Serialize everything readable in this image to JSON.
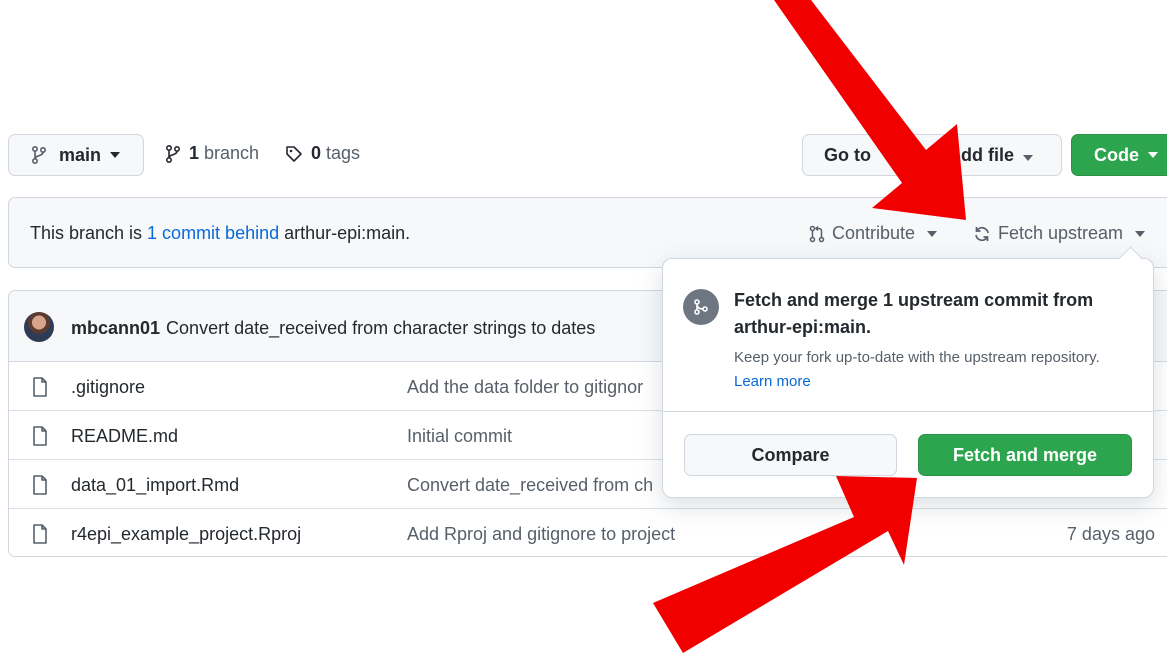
{
  "branch_bar": {
    "branch_name": "main",
    "branch_count": "1",
    "branch_label": "branch",
    "tag_count": "0",
    "tag_label": "tags",
    "goto_label": "Go to",
    "add_file_label": "dd file",
    "code_label": "Code"
  },
  "behind_bar": {
    "prefix": "This branch is ",
    "link": "1 commit behind",
    "suffix": " arthur-epi:main.",
    "contribute_label": "Contribute",
    "fetch_label": "Fetch upstream"
  },
  "latest_commit": {
    "author": "mbcann01",
    "message": "Convert date_received from character strings to dates"
  },
  "files": [
    {
      "name": ".gitignore",
      "message": "Add the data folder to gitignor",
      "age": ""
    },
    {
      "name": "README.md",
      "message": "Initial commit",
      "age": ""
    },
    {
      "name": "data_01_import.Rmd",
      "message": "Convert date_received from ch",
      "age": ""
    },
    {
      "name": "r4epi_example_project.Rproj",
      "message": "Add Rproj and gitignore to project",
      "age": "7 days ago"
    }
  ],
  "popover": {
    "title": "Fetch and merge 1 upstream commit from arthur-epi:main.",
    "desc": "Keep your fork up-to-date with the upstream repository.",
    "learn_more": "Learn more",
    "compare_label": "Compare",
    "merge_label": "Fetch and merge"
  },
  "colors": {
    "accent_green": "#2da44e",
    "link_blue": "#0969da",
    "annotation_red": "#f20000"
  },
  "icons": [
    "git-branch-icon",
    "tag-icon",
    "git-pull-request-icon",
    "sync-icon",
    "file-icon",
    "git-merge-icon"
  ]
}
